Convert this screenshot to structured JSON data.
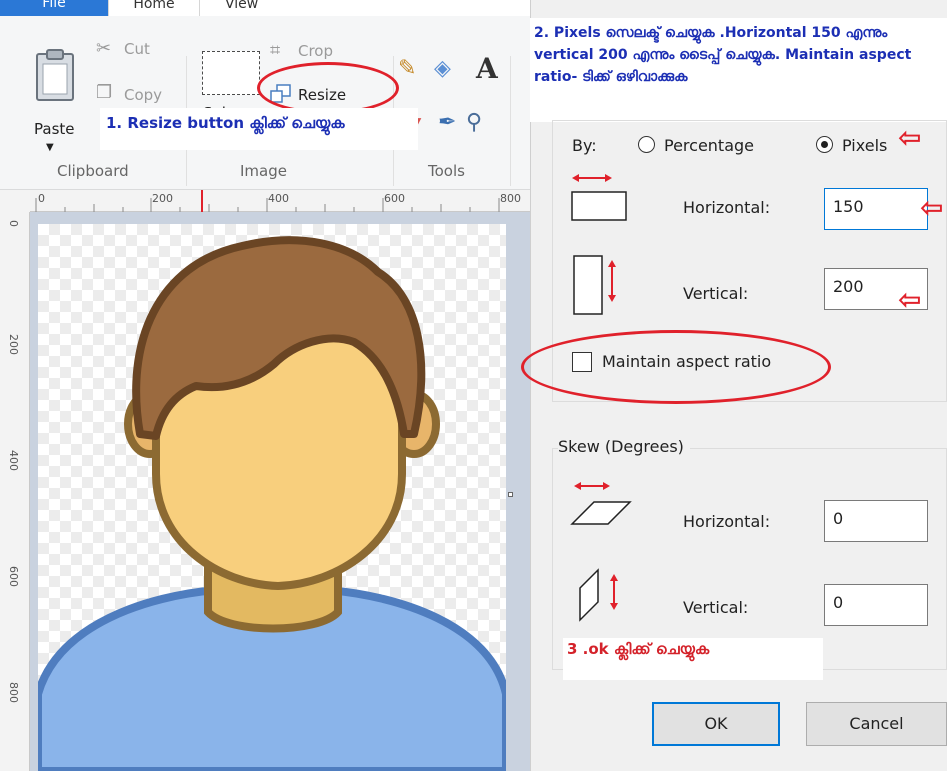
{
  "ribbon": {
    "tabs": {
      "file": "File",
      "home": "Home",
      "view": "View"
    },
    "clipboard": {
      "paste": "Paste",
      "cut": "Cut",
      "copy": "Copy",
      "group_label": "Clipboard"
    },
    "image": {
      "crop": "Crop",
      "resize": "Resize",
      "select_partial": "Selec",
      "group_label": "Image"
    },
    "tools": {
      "group_label": "Tools",
      "text_tool": "A"
    }
  },
  "ruler": {
    "top_ticks": [
      "0",
      "200",
      "400",
      "600",
      "800"
    ],
    "left_ticks": [
      "0",
      "200",
      "400",
      "600",
      "800"
    ]
  },
  "annotations": {
    "note1": "1. Resize button ക്ലിക്ക് ചെയ്യുക",
    "note2": "2. Pixels സെലക്ട് ചെയ്യുക .Horizontal 150 എന്നും vertical 200 എന്നും ടൈപ്പ് ചെയ്യുക. Maintain aspect ratio- ടിക്ക് ഒഴിവാക്കുക",
    "note3": "3 .ok ക്ലിക്ക് ചെയ്യുക"
  },
  "dialog": {
    "resize": {
      "by_label": "By:",
      "percentage_label": "Percentage",
      "pixels_label": "Pixels",
      "selected_unit": "Pixels",
      "horizontal_label": "Horizontal:",
      "horizontal_value": "150",
      "vertical_label": "Vertical:",
      "vertical_value": "200",
      "maintain_label": "Maintain aspect ratio",
      "maintain_checked": false
    },
    "skew": {
      "title": "Skew (Degrees)",
      "horizontal_label": "Horizontal:",
      "horizontal_value": "0",
      "vertical_label": "Vertical:",
      "vertical_value": "0"
    },
    "ok_label": "OK",
    "cancel_label": "Cancel"
  },
  "colors": {
    "annotation_red": "#e0212b",
    "annotation_blue": "#1c2fb4",
    "file_tab_blue": "#2b78d6",
    "hair_brown": "#9b6a3f",
    "skin": "#f8cf7d",
    "shirt_blue": "#8ab4ea"
  }
}
